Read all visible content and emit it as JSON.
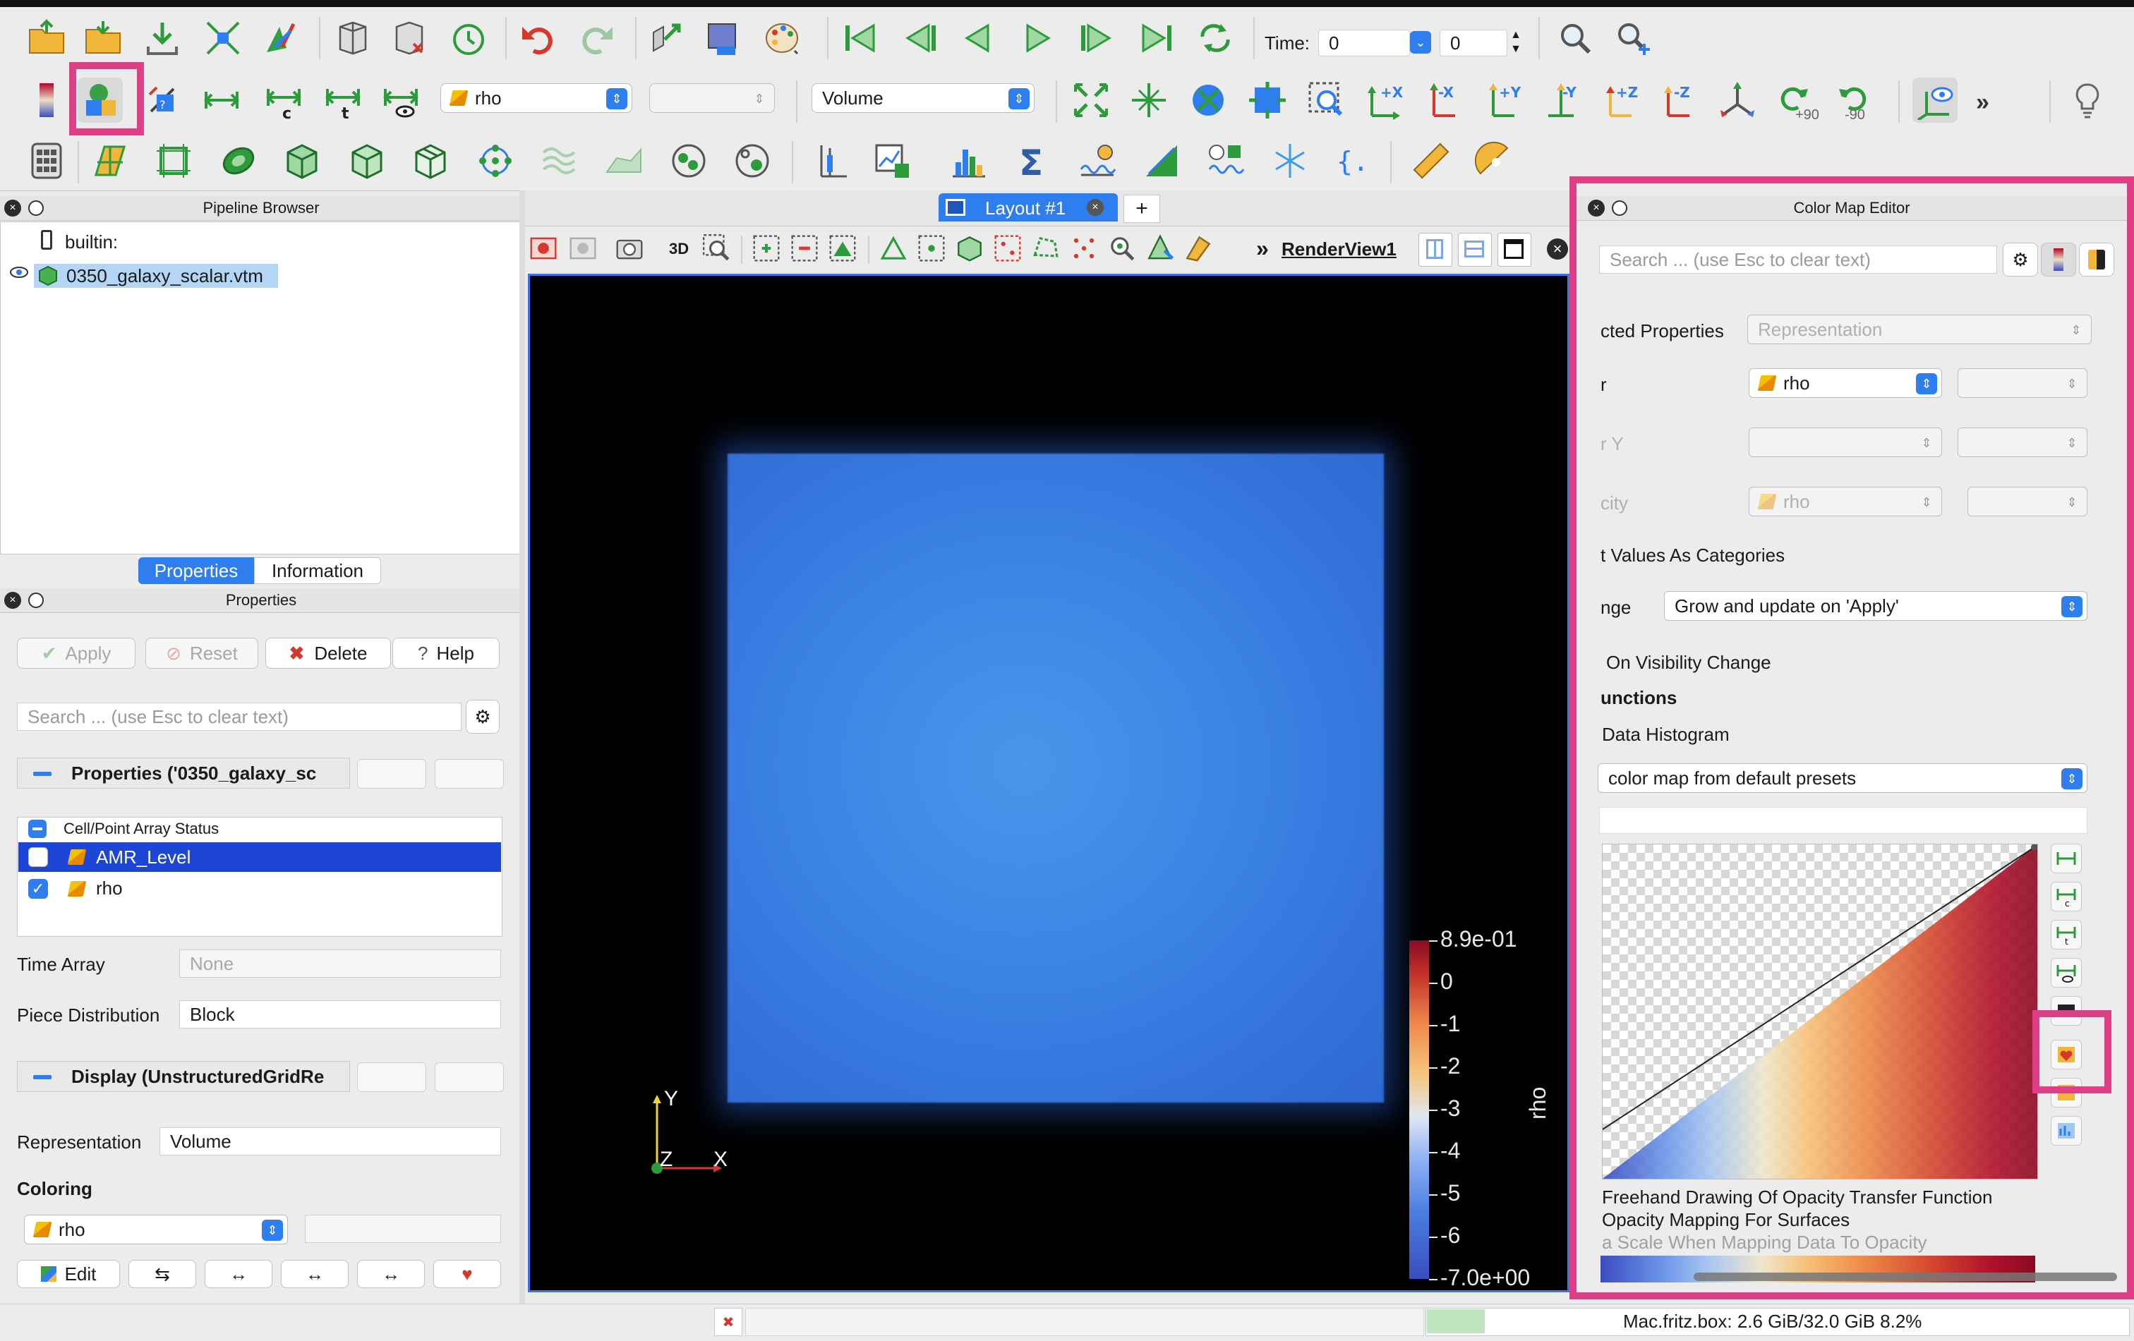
{
  "toolbar": {
    "time_label": "Time:",
    "time_value": "0",
    "time_index": "0",
    "array_selector": "rho",
    "component_selector": "",
    "representation_selector": "Volume",
    "rotate_plus": "+90",
    "rotate_minus": "-90"
  },
  "pipeline": {
    "title": "Pipeline Browser",
    "server": "builtin:",
    "source": "0350_galaxy_scalar.vtm"
  },
  "tabs": {
    "properties": "Properties",
    "information": "Information"
  },
  "properties": {
    "title": "Properties",
    "apply": "Apply",
    "reset": "Reset",
    "delete": "Delete",
    "help": "Help",
    "search_placeholder": "Search ... (use Esc to clear text)",
    "section_properties": "Properties ('0350_galaxy_sc",
    "array_status_header": "Cell/Point Array Status",
    "arrays": [
      {
        "name": "AMR_Level",
        "checked": false,
        "selected": true
      },
      {
        "name": "rho",
        "checked": true,
        "selected": false
      }
    ],
    "time_array_label": "Time Array",
    "time_array_value": "None",
    "piece_distribution_label": "Piece Distribution",
    "piece_distribution_value": "Block",
    "section_display": "Display (UnstructuredGridRe",
    "representation_label": "Representation",
    "representation_value": "Volume",
    "coloring_label": "Coloring",
    "coloring_value": "rho",
    "edit_label": "Edit"
  },
  "layout": {
    "tab_label": "Layout #1",
    "add_tab": "+",
    "view_3d": "3D",
    "render_view_label": "RenderView1"
  },
  "colorbar": {
    "title": "rho",
    "ticks": [
      "8.9e-01",
      "0",
      "-1",
      "-2",
      "-3",
      "-4",
      "-5",
      "-6",
      "-7.0e+00"
    ]
  },
  "axes": {
    "y": "Y",
    "z": "Z",
    "x": "X"
  },
  "color_map_editor": {
    "title": "Color Map Editor",
    "search_placeholder": "Search ... (use Esc to clear text)",
    "selected_properties_label": "cted Properties",
    "selected_properties_value": "Representation",
    "color_label": "r",
    "color_value": "rho",
    "color_y_label": "r Y",
    "opacity_label": "city",
    "opacity_value": "rho",
    "interpret_label": "t Values As Categories",
    "range_label": "nge",
    "range_value": "Grow and update on 'Apply'",
    "visibility_label": "On Visibility Change",
    "functions_label": "unctions",
    "histogram_label": "Data Histogram",
    "preset_value": "color map from default presets",
    "freehand_label": "Freehand Drawing Of Opacity Transfer Function",
    "opacity_surfaces_label": "Opacity Mapping For Surfaces",
    "scale_label": "a Scale When Mapping Data To Opacity"
  },
  "status": {
    "memory": "Mac.fritz.box: 2.6 GiB/32.0 GiB 8.2%"
  }
}
